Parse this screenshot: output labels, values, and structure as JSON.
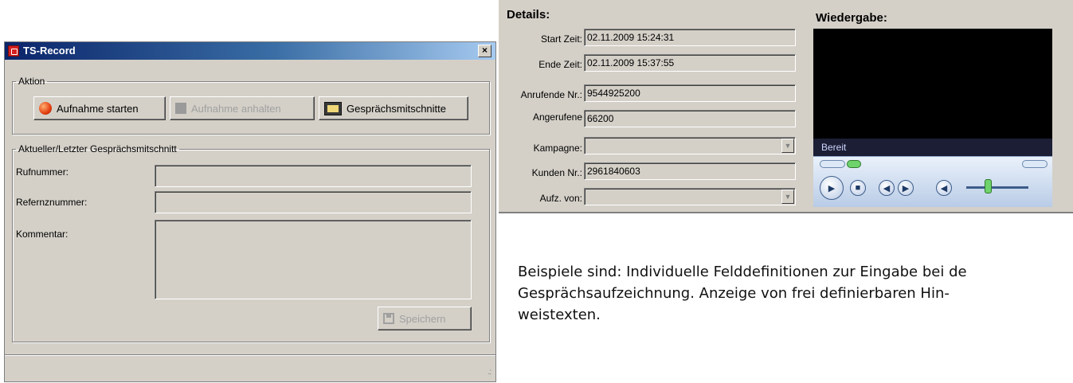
{
  "dialog": {
    "title": "TS-Record",
    "close_label": "×",
    "aktion_group_label": "Aktion",
    "buttons": {
      "start_label": "Aufnahme starten",
      "pause_label": "Aufnahme anhalten",
      "recordings_label": "Gesprächsmitschnitte"
    },
    "current_group_label": "Aktueller/Letzter Gesprächsmitschnitt",
    "rufnummer_label": "Rufnummer:",
    "referenz_label": "Refernznummer:",
    "kommentar_label": "Kommentar:",
    "rufnummer_value": "",
    "referenz_value": "",
    "kommentar_value": "",
    "save_label": "Speichern",
    "resize_grip": ".:"
  },
  "details": {
    "heading": "Details:",
    "fields": {
      "start": {
        "label": "Start Zeit:",
        "value": "02.11.2009 15:24:31"
      },
      "end": {
        "label": "Ende Zeit:",
        "value": "02.11.2009 15:37:55"
      },
      "anrufende": {
        "label": "Anrufende Nr.:",
        "value": "9544925200"
      },
      "angerufene": {
        "label": "Angerufene",
        "value": "66200"
      },
      "kampagne": {
        "label": "Kampagne:",
        "value": ""
      },
      "kunden": {
        "label": "Kunden Nr.:",
        "value": "2961840603"
      },
      "aufz": {
        "label": "Aufz. von:",
        "value": ""
      }
    }
  },
  "player": {
    "heading": "Wiedergabe:",
    "status": "Bereit",
    "volume_level": 0.3
  },
  "description": {
    "text": "Beispiele sind: Individuelle Felddefinitionen zur Eingabe bei de Gesprächsaufzeichnung. Anzeige von frei definierbaren Hin-weistexten.",
    "line1": "Beispiele sind: Individuelle Felddefinitionen zur Eingabe bei de",
    "line2": "Gesprächsaufzeichnung. Anzeige von frei definierbaren Hin-",
    "line3": "weistexten."
  }
}
